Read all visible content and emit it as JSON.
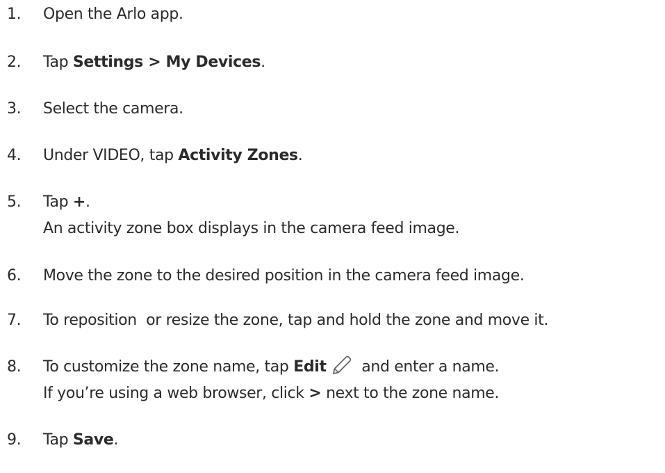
{
  "steps": [
    {
      "number": "1.",
      "text": "Open the Arlo app."
    },
    {
      "number": "2.",
      "pre": "Tap ",
      "bold1": "Settings",
      "mid": " > ",
      "bold2": "My Devices",
      "post": "."
    },
    {
      "number": "3.",
      "text": "Select the camera."
    },
    {
      "number": "4.",
      "pre": "Under VIDEO, tap ",
      "bold": "Activity Zones",
      "post": "."
    },
    {
      "number": "5.",
      "pre": "Tap ",
      "bold": "+",
      "post": ".",
      "line2": "An activity zone box displays in the camera feed image."
    },
    {
      "number": "6.",
      "text": "Move the zone to the desired position in the camera feed image."
    },
    {
      "number": "7.",
      "text": "To reposition  or resize the zone, tap and hold the zone and move it."
    },
    {
      "number": "8.",
      "pre": "To customize the zone name, tap ",
      "bold": "Edit",
      "icon": "pencil-icon",
      "post": " and enter a name.",
      "line2_pre": "If you’re using a web browser, click ",
      "line2_bold": ">",
      "line2_post": " next to the zone name."
    },
    {
      "number": "9.",
      "pre": "Tap ",
      "bold": "Save",
      "post": "."
    }
  ],
  "colors": {
    "text": "#2b2b2b",
    "icon": "#666666"
  }
}
